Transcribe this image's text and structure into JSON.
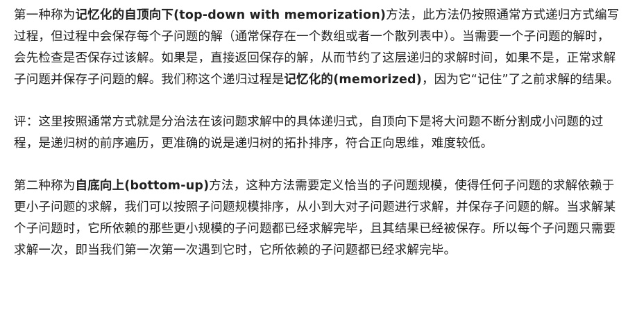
{
  "paragraphs": {
    "p1": {
      "t1": "第一种称为",
      "b1": "记忆化的自顶向下(top-down with memorization)",
      "t2": "方法，此方法仍按照通常方式递归方式编写过程，但过程中会保存每个子问题的解（通常保存在一个数组或者一个散列表中）。当需要一个子问题的解时，会先检查是否保存过该解。如果是，直接返回保存的解，从而节约了这层递归的求解时间，如果不是，正常求解子问题并保存子问题的解。我们称这个递归过程是",
      "b2": "记忆化的(memorized)",
      "t3": "，因为它“记住”了之前求解的结果。"
    },
    "p2": {
      "t1": "评：这里按照通常方式就是分治法在该问题求解中的具体递归式，自顶向下是将大问题不断分割成小问题的过程，是递归树的前序遍历，更准确的说是递归树的拓扑排序，符合正向思维，难度较低。"
    },
    "p3": {
      "t1": "第二种称为",
      "b1": "自底向上(bottom-up)",
      "t2": "方法，这种方法需要定义恰当的子问题规模，使得任何子问题的求解依赖于更小子问题的求解，我们可以按照子问题规模排序，从小到大对子问题进行求解，并保存子问题的解。当求解某个子问题时，它所依赖的那些更小规模的子问题都已经求解完毕，且其结果已经被保存。所以每个子问题只需要求解一次，即当我们第一次第一次遇到它时，它所依赖的子问题都已经求解完毕。"
    }
  }
}
